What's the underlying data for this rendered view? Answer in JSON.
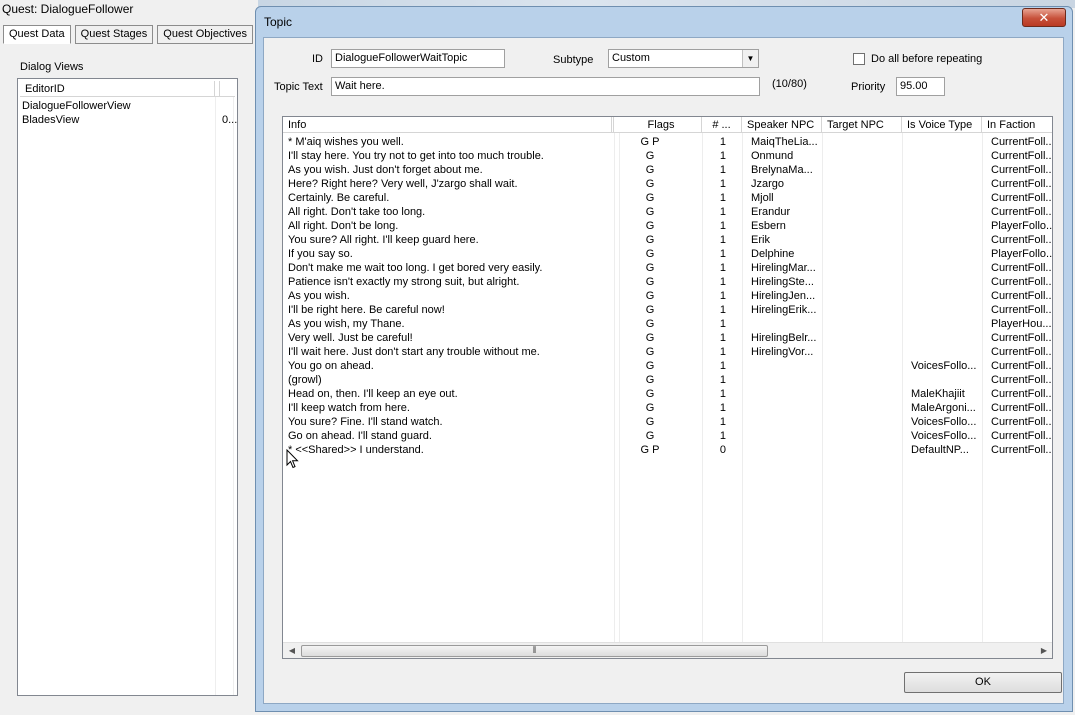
{
  "quest": {
    "title": "Quest: DialogueFollower",
    "tabs": [
      "Quest Data",
      "Quest Stages",
      "Quest Objectives"
    ],
    "dialog_views_label": "Dialog Views",
    "views_header": "EditorID",
    "views": [
      {
        "editor_id": "DialogueFollowerView",
        "extra": ""
      },
      {
        "editor_id": "BladesView",
        "extra": "0..."
      }
    ]
  },
  "topic": {
    "title": "Topic",
    "close_glyph": "✕",
    "id_label": "ID",
    "id_value": "DialogueFollowerWaitTopic",
    "subtype_label": "Subtype",
    "subtype_value": "Custom",
    "do_all_label": "Do all before repeating",
    "topic_text_label": "Topic Text",
    "topic_text_value": "Wait here.",
    "char_count": "(10/80)",
    "priority_label": "Priority",
    "priority_value": "95.00",
    "ok_label": "OK",
    "columns": [
      "Info",
      "Flags",
      "# ...",
      "Speaker NPC",
      "Target NPC",
      "Is Voice Type",
      "In Faction"
    ],
    "rows": [
      {
        "info": "* M'aiq wishes you well.",
        "flags": "G  P",
        "num": "1",
        "speaker": "MaiqTheLia...",
        "target": "",
        "voice": "",
        "faction": "CurrentFoll..."
      },
      {
        "info": "I'll stay here. You try not to get into too much trouble.",
        "flags": "G",
        "num": "1",
        "speaker": "Onmund",
        "target": "",
        "voice": "",
        "faction": "CurrentFoll..."
      },
      {
        "info": "As you wish. Just don't forget about me.",
        "flags": "G",
        "num": "1",
        "speaker": "BrelynaMa...",
        "target": "",
        "voice": "",
        "faction": "CurrentFoll..."
      },
      {
        "info": "Here? Right here? Very well, J'zargo shall wait.",
        "flags": "G",
        "num": "1",
        "speaker": "Jzargo",
        "target": "",
        "voice": "",
        "faction": "CurrentFoll..."
      },
      {
        "info": "Certainly. Be careful.",
        "flags": "G",
        "num": "1",
        "speaker": "Mjoll",
        "target": "",
        "voice": "",
        "faction": "CurrentFoll..."
      },
      {
        "info": "All right. Don't take too long.",
        "flags": "G",
        "num": "1",
        "speaker": "Erandur",
        "target": "",
        "voice": "",
        "faction": "CurrentFoll..."
      },
      {
        "info": "All right. Don't be long.",
        "flags": "G",
        "num": "1",
        "speaker": "Esbern",
        "target": "",
        "voice": "",
        "faction": "PlayerFollo..."
      },
      {
        "info": "You sure? All right. I'll keep guard here.",
        "flags": "G",
        "num": "1",
        "speaker": "Erik",
        "target": "",
        "voice": "",
        "faction": "CurrentFoll..."
      },
      {
        "info": "If you say so.",
        "flags": "G",
        "num": "1",
        "speaker": "Delphine",
        "target": "",
        "voice": "",
        "faction": "PlayerFollo..."
      },
      {
        "info": "Don't make me wait too long. I get bored very easily.",
        "flags": "G",
        "num": "1",
        "speaker": "HirelingMar...",
        "target": "",
        "voice": "",
        "faction": "CurrentFoll..."
      },
      {
        "info": "Patience isn't exactly my strong suit, but alright.",
        "flags": "G",
        "num": "1",
        "speaker": "HirelingSte...",
        "target": "",
        "voice": "",
        "faction": "CurrentFoll..."
      },
      {
        "info": "As you wish.",
        "flags": "G",
        "num": "1",
        "speaker": "HirelingJen...",
        "target": "",
        "voice": "",
        "faction": "CurrentFoll..."
      },
      {
        "info": "I'll be right here. Be careful now!",
        "flags": "G",
        "num": "1",
        "speaker": "HirelingErik...",
        "target": "",
        "voice": "",
        "faction": "CurrentFoll..."
      },
      {
        "info": "As you wish, my Thane.",
        "flags": "G",
        "num": "1",
        "speaker": "",
        "target": "",
        "voice": "",
        "faction": "PlayerHou..."
      },
      {
        "info": "Very well. Just be careful!",
        "flags": "G",
        "num": "1",
        "speaker": "HirelingBelr...",
        "target": "",
        "voice": "",
        "faction": "CurrentFoll..."
      },
      {
        "info": "I'll wait here. Just don't start any trouble without me.",
        "flags": "G",
        "num": "1",
        "speaker": "HirelingVor...",
        "target": "",
        "voice": "",
        "faction": "CurrentFoll..."
      },
      {
        "info": "You go on ahead.",
        "flags": "G",
        "num": "1",
        "speaker": "",
        "target": "",
        "voice": "VoicesFollo...",
        "faction": "CurrentFoll..."
      },
      {
        "info": "(growl)",
        "flags": "G",
        "num": "1",
        "speaker": "",
        "target": "",
        "voice": "",
        "faction": "CurrentFoll..."
      },
      {
        "info": "Head on, then. I'll keep an eye out.",
        "flags": "G",
        "num": "1",
        "speaker": "",
        "target": "",
        "voice": "MaleKhajiit",
        "faction": "CurrentFoll..."
      },
      {
        "info": "I'll keep watch from here.",
        "flags": "G",
        "num": "1",
        "speaker": "",
        "target": "",
        "voice": "MaleArgoni...",
        "faction": "CurrentFoll..."
      },
      {
        "info": "You sure? Fine. I'll stand watch.",
        "flags": "G",
        "num": "1",
        "speaker": "",
        "target": "",
        "voice": "VoicesFollo...",
        "faction": "CurrentFoll..."
      },
      {
        "info": "Go on ahead. I'll stand guard.",
        "flags": "G",
        "num": "1",
        "speaker": "",
        "target": "",
        "voice": "VoicesFollo...",
        "faction": "CurrentFoll..."
      },
      {
        "info": "* <<Shared>> I understand.",
        "flags": "G  P",
        "num": "0",
        "speaker": "",
        "target": "",
        "voice": "DefaultNP...",
        "faction": "CurrentFoll..."
      }
    ]
  }
}
